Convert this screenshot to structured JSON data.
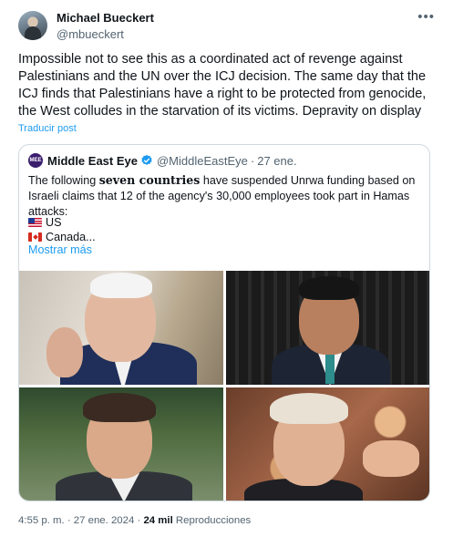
{
  "author": {
    "name": "Michael Bueckert",
    "handle": "@mbueckert"
  },
  "tweet": {
    "text": "Impossible not to see this as a coordinated act of revenge against Palestinians and the UN over the ICJ decision. The same day that the ICJ finds that Palestinians have a right to be protected from genocide, the West colludes in the starvation of its victims. Depravity on display",
    "translate_label": "Traducir post"
  },
  "more_icon": "more-horizontal-icon",
  "quoted": {
    "logo_text": "MEE",
    "name": "Middle East Eye",
    "verified_icon": "verified-badge-icon",
    "handle": "@MiddleEastEye",
    "separator": "·",
    "time": "27 ene.",
    "text_before": "The following ",
    "text_bold": "seven countries",
    "text_after": " have suspended Unrwa funding based on Israeli claims that 12 of the agency's 30,000 employees took part in Hamas attacks:",
    "lines": [
      {
        "flag": "us-flag-icon",
        "text": "US"
      },
      {
        "flag": "canada-flag-icon",
        "text": "Canada..."
      }
    ],
    "show_more": "Mostrar más"
  },
  "footer": {
    "time": "4:55 p. m.",
    "sep1": "·",
    "date": "27 ene. 2024",
    "sep2": "·",
    "views_count": "24 mil",
    "views_label": "Reproducciones"
  },
  "colors": {
    "accent": "#1d9bf0",
    "text": "#0f1419",
    "secondary_text": "#536471",
    "border": "#cfd9de"
  }
}
